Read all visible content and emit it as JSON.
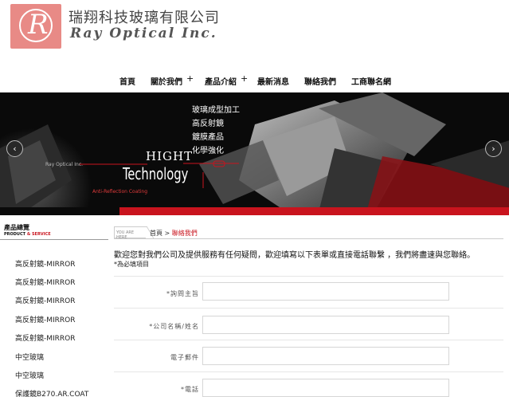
{
  "header": {
    "logo_letter": "R",
    "company_cn": "瑞翔科技玻璃有限公司",
    "company_en": "Ray Optical Inc."
  },
  "nav": {
    "items": [
      "首頁",
      "關於我們",
      "產品介紹",
      "最新消息",
      "聯絡我們",
      "工商聯名網"
    ],
    "plus": "+"
  },
  "banner": {
    "list": [
      "玻璃成型加工",
      "高反射鏡",
      "鍍膜產品",
      "化學強化"
    ],
    "hight": "HIGHT",
    "technology": "Technology",
    "brand_small": "Ray Optical Inc.",
    "ar_label": "Anti-Reflection Coating",
    "prev_icon": "‹",
    "next_icon": "›"
  },
  "sidebar": {
    "title": "產品總覽",
    "sub_product": "PRODUCT",
    "sub_amp": "&",
    "sub_service": "SERVICE",
    "items": [
      "高反射鏡-MIRROR",
      "高反射鏡-MIRROR",
      "高反射鏡-MIRROR",
      "高反射鏡-MIRROR",
      "高反射鏡-MIRROR",
      "中空玻璃",
      "中空玻璃",
      "保護鏡B270.AR.COAT"
    ]
  },
  "main": {
    "you_are_here": "YOU ARE HERE",
    "crumb_home": "首頁",
    "crumb_sep": ">",
    "crumb_current": "聯絡我們",
    "intro": "歡迎您對我們公司及提供服務有任何疑問，歡迎填寫以下表單或直接電話聯繫 ，我們將盡速與您聯絡。",
    "required_note": "*為必填項目",
    "fields": [
      {
        "label": "*詢問主旨",
        "value": ""
      },
      {
        "label": "*公司名稱/姓名",
        "value": ""
      },
      {
        "label": "電子郵件",
        "value": ""
      },
      {
        "label": "*電話",
        "value": ""
      }
    ]
  },
  "colors": {
    "brand_red": "#c9141e",
    "logo_pink": "#e88a86"
  }
}
